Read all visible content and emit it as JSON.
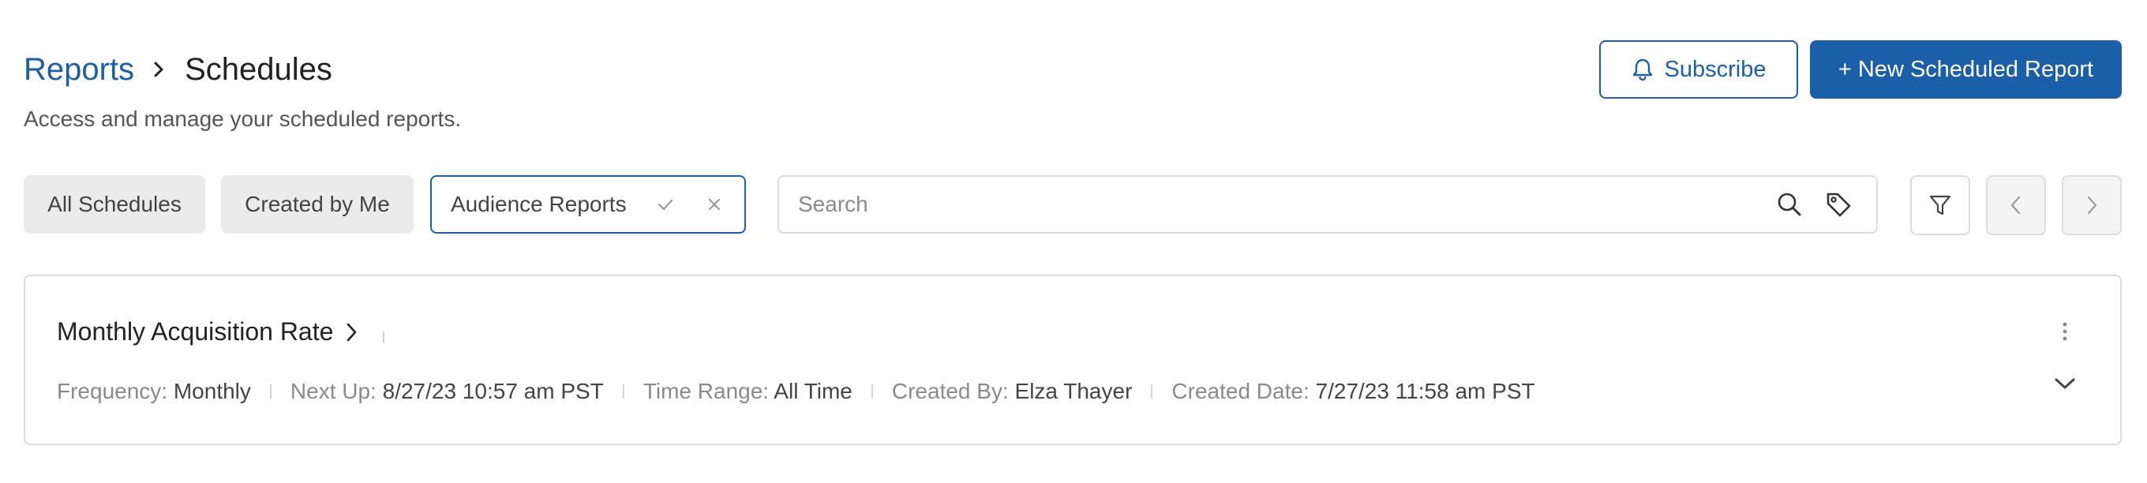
{
  "header": {
    "breadcrumb": {
      "parent": "Reports",
      "current": "Schedules"
    },
    "subtitle": "Access and manage your scheduled reports.",
    "subscribe_label": "Subscribe",
    "new_report_label": "+ New Scheduled Report"
  },
  "filters": {
    "chips": [
      {
        "label": "All Schedules"
      },
      {
        "label": "Created by Me"
      }
    ],
    "active_chip": {
      "label": "Audience Reports"
    },
    "search": {
      "placeholder": "Search",
      "value": ""
    }
  },
  "schedules": [
    {
      "title": "Monthly Acquisition Rate",
      "meta": [
        {
          "label": "Frequency:",
          "value": "Monthly"
        },
        {
          "label": "Next Up:",
          "value": "8/27/23 10:57 am PST"
        },
        {
          "label": "Time Range:",
          "value": "All Time"
        },
        {
          "label": "Created By:",
          "value": "Elza Thayer"
        },
        {
          "label": "Created Date:",
          "value": "7/27/23 11:58 am PST"
        }
      ]
    }
  ],
  "icons": {
    "subscribe": "bell-icon",
    "confirm": "check-icon",
    "clear": "close-icon",
    "search": "search-icon",
    "tag": "tag-icon",
    "filter": "filter-icon",
    "prev": "chevron-left-icon",
    "next": "chevron-right-icon",
    "more": "kebab-icon",
    "expand": "chevron-down-icon"
  },
  "colors": {
    "accent": "#1a5fa8",
    "chip_bg": "#ebebeb",
    "border": "#dcdcdc",
    "muted_text": "#8a8a8a"
  }
}
